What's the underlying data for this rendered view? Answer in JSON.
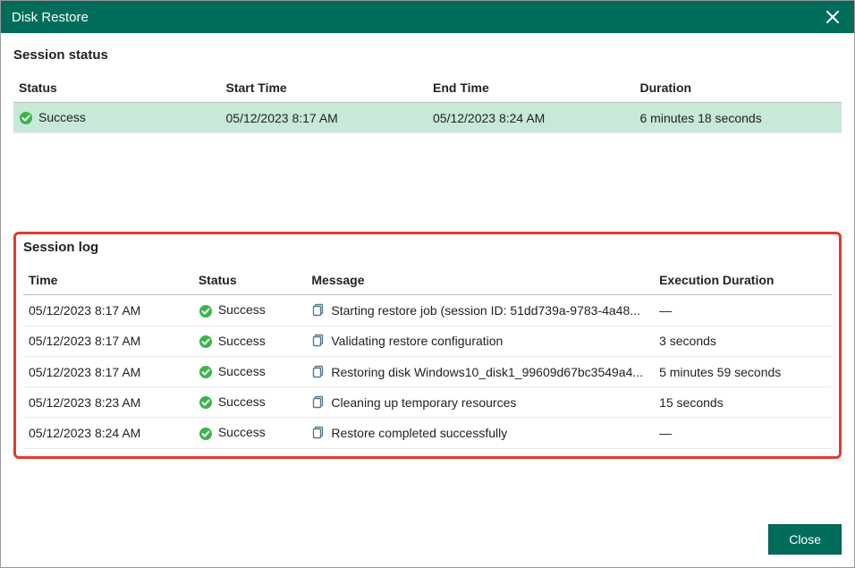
{
  "window": {
    "title": "Disk Restore"
  },
  "sessionStatus": {
    "heading": "Session status",
    "columns": {
      "status": "Status",
      "startTime": "Start Time",
      "endTime": "End Time",
      "duration": "Duration"
    },
    "row": {
      "statusLabel": "Success",
      "startTime": "05/12/2023 8:17 AM",
      "endTime": "05/12/2023 8:24 AM",
      "duration": "6 minutes 18 seconds"
    }
  },
  "sessionLog": {
    "heading": "Session log",
    "columns": {
      "time": "Time",
      "status": "Status",
      "message": "Message",
      "execDuration": "Execution Duration"
    },
    "rows": [
      {
        "time": "05/12/2023 8:17 AM",
        "status": "Success",
        "message": "Starting restore job (session ID: 51dd739a-9783-4a48...",
        "execDuration": "—"
      },
      {
        "time": "05/12/2023 8:17 AM",
        "status": "Success",
        "message": "Validating restore configuration",
        "execDuration": "3 seconds"
      },
      {
        "time": "05/12/2023 8:17 AM",
        "status": "Success",
        "message": "Restoring disk Windows10_disk1_99609d67bc3549a4...",
        "execDuration": "5 minutes 59 seconds"
      },
      {
        "time": "05/12/2023 8:23 AM",
        "status": "Success",
        "message": "Cleaning up temporary resources",
        "execDuration": "15 seconds"
      },
      {
        "time": "05/12/2023 8:24 AM",
        "status": "Success",
        "message": "Restore completed successfully",
        "execDuration": "—"
      }
    ]
  },
  "footer": {
    "closeLabel": "Close"
  }
}
